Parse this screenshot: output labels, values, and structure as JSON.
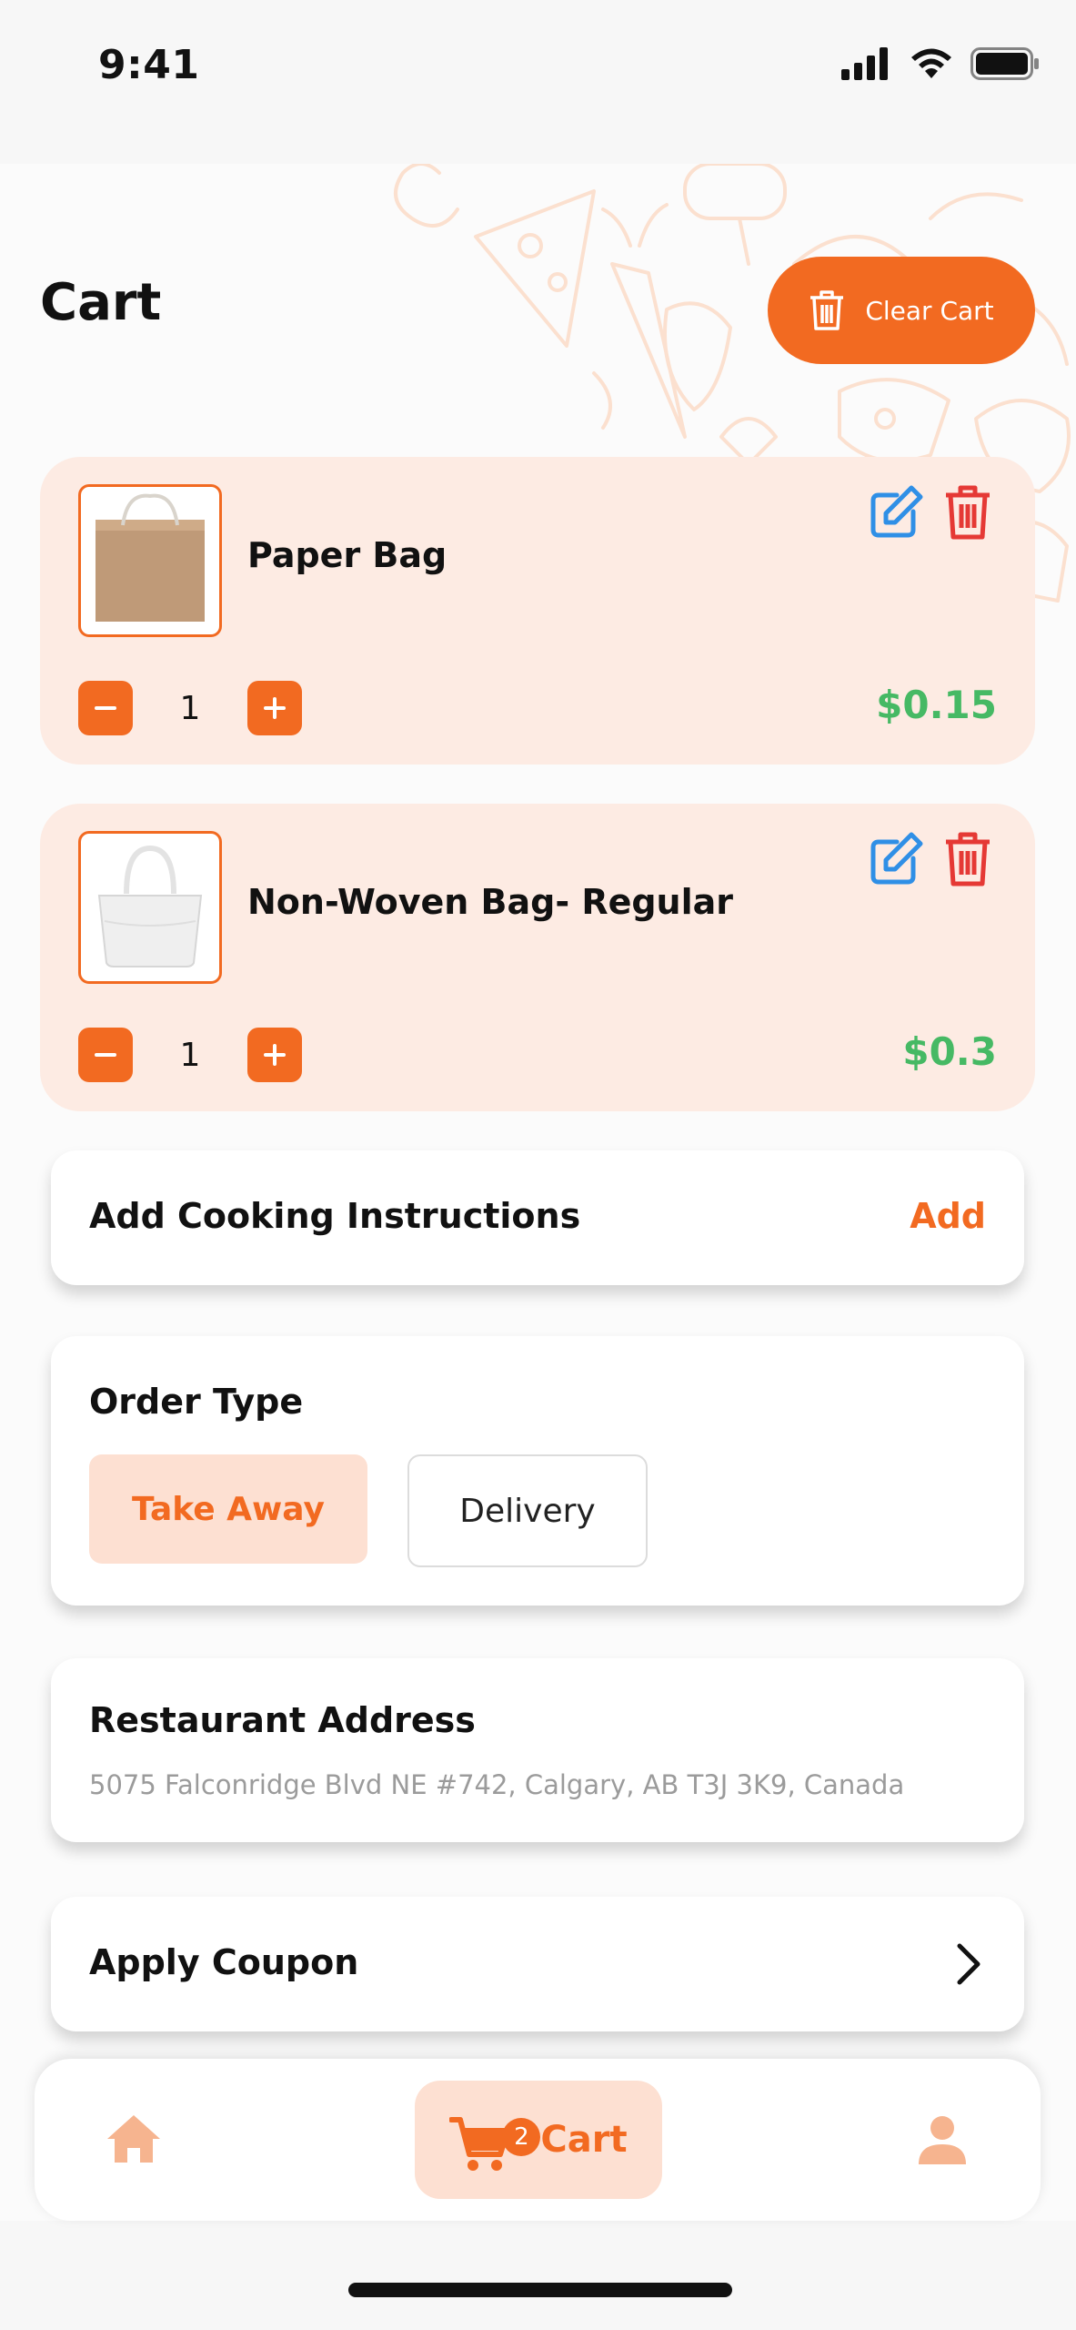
{
  "status_bar": {
    "time": "9:41"
  },
  "header": {
    "title": "Cart",
    "clear_label": "Clear Cart"
  },
  "cart_items": [
    {
      "name": "Paper Bag",
      "quantity": "1",
      "price": "$0.15",
      "image": "paper-bag"
    },
    {
      "name": "Non-Woven Bag- Regular",
      "quantity": "1",
      "price": "$0.3",
      "image": "tote-bag"
    }
  ],
  "cooking": {
    "label": "Add Cooking Instructions",
    "action": "Add"
  },
  "order_type": {
    "title": "Order Type",
    "options": [
      "Take Away",
      "Delivery"
    ],
    "selected": "Take Away"
  },
  "address": {
    "title": "Restaurant Address",
    "value": "5075 Falconridge Blvd NE #742, Calgary, AB T3J 3K9, Canada"
  },
  "coupon": {
    "label": "Apply Coupon"
  },
  "bottom_nav": {
    "cart_label": "Cart",
    "cart_badge": "2",
    "items": [
      "home-icon",
      "cart-icon",
      "profile-icon"
    ]
  },
  "colors": {
    "accent": "#f26a21",
    "accent_light": "#fdebe3",
    "price": "#46b964",
    "edit": "#2f8fe6",
    "delete": "#e53935"
  }
}
